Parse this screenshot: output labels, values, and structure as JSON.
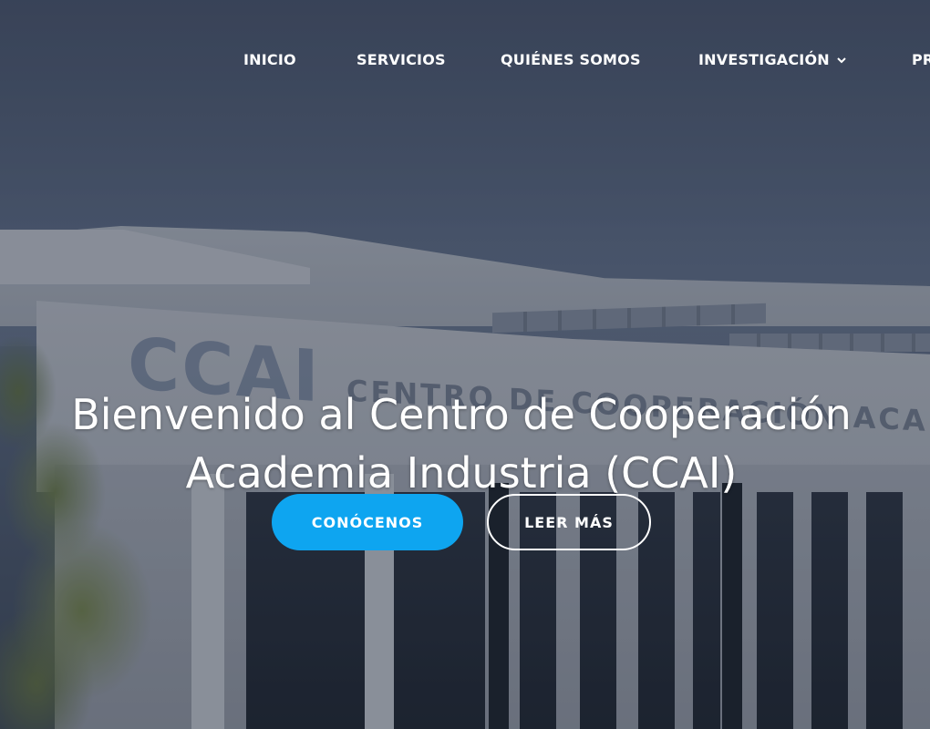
{
  "nav": {
    "items": [
      {
        "label": "INICIO"
      },
      {
        "label": "SERVICIOS"
      },
      {
        "label": "QUIÉNES SOMOS"
      },
      {
        "label": "INVESTIGACIÓN",
        "icon": "chevron-down-icon"
      },
      {
        "label": "PR"
      }
    ]
  },
  "hero": {
    "background_sign_text": "CCAI",
    "background_sign_subtext": "CENTRO DE COOPERACIÓN ACADEMIA INDUSTRIA",
    "title_line1": "Bienvenido al Centro de Cooperación",
    "title_line2": "Academia Industria (CCAI)",
    "primary_button": "CONÓCENOS",
    "secondary_button": "LEER MÁS"
  },
  "colors": {
    "accent": "#0ea5f0",
    "text": "#ffffff"
  }
}
